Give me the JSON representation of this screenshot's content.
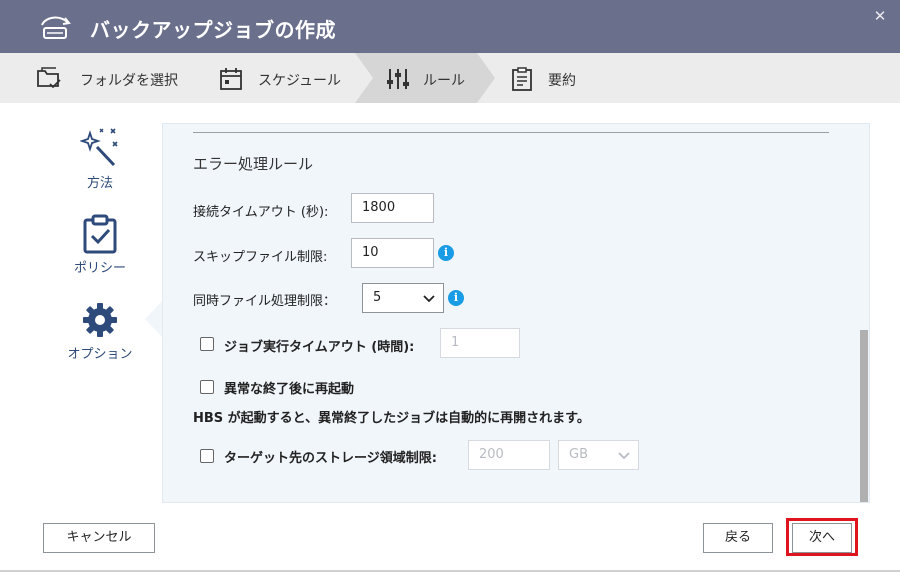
{
  "window": {
    "title": "バックアップジョブの作成",
    "close_glyph": "✕"
  },
  "steps": [
    {
      "label": "フォルダを選択",
      "icon": "folder-check-icon"
    },
    {
      "label": "スケジュール",
      "icon": "calendar-icon"
    },
    {
      "label": "ルール",
      "icon": "sliders-icon",
      "active": true
    },
    {
      "label": "要約",
      "icon": "clipboard-icon"
    }
  ],
  "sidebar": {
    "items": [
      {
        "label": "方法",
        "icon": "magic-wand-icon"
      },
      {
        "label": "ポリシー",
        "icon": "clipboard-check-icon"
      },
      {
        "label": "オプション",
        "icon": "gear-icon",
        "active": true
      }
    ]
  },
  "panel": {
    "section_title": "エラー処理ルール",
    "timeout_label": "接続タイムアウト (秒):",
    "timeout_value": "1800",
    "skip_label": "スキップファイル制限:",
    "skip_value": "10",
    "concurrent_label": "同時ファイル処理制限：",
    "concurrent_value": "5",
    "job_timeout_label": "ジョブ実行タイムアウト (時間):",
    "job_timeout_value": "1",
    "restart_label": "異常な終了後に再起動",
    "restart_note": "HBS が起動すると、異常終了したジョブは自動的に再開されます。",
    "storage_label": "ターゲット先のストレージ領域制限:",
    "storage_value": "200",
    "storage_unit": "GB",
    "info_glyph": "i"
  },
  "footer": {
    "cancel": "キャンセル",
    "back": "戻る",
    "next": "次へ"
  },
  "colors": {
    "titlebar": "#6a6f8c",
    "accent": "#2e4a7a",
    "info": "#1a9be6",
    "highlight": "#e0141e"
  }
}
